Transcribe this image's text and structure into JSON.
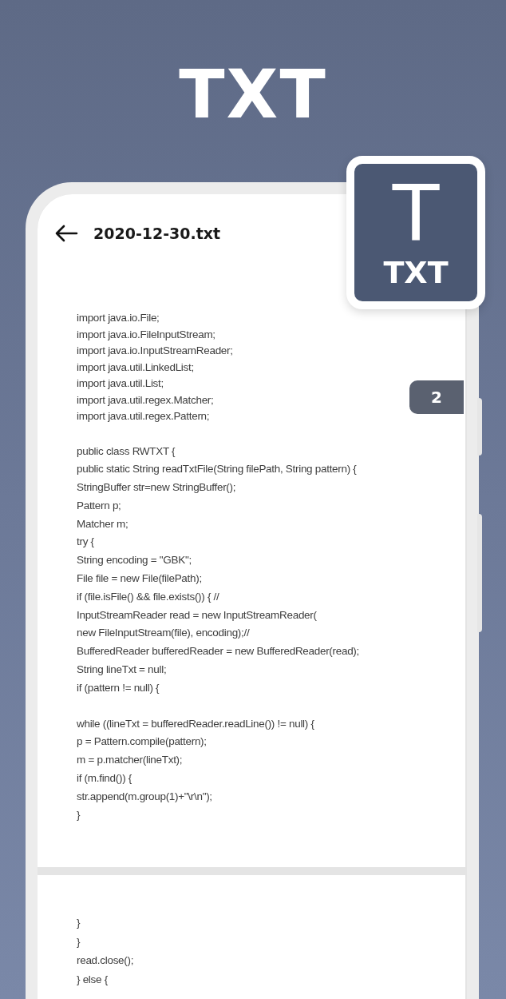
{
  "headline": "TXT",
  "badge": {
    "glyph": "T",
    "label": "TXT"
  },
  "header": {
    "title": "2020-12-30.txt"
  },
  "page_indicator": "2",
  "pages": [
    {
      "blocks": [
        [
          "import java.io.File;",
          "import java.io.FileInputStream;",
          "import java.io.InputStreamReader;",
          "import java.util.LinkedList;",
          "import java.util.List;",
          "import java.util.regex.Matcher;",
          "import java.util.regex.Pattern;"
        ],
        [
          "public class RWTXT {",
          "public static String readTxtFile(String filePath, String pattern) {",
          "StringBuffer str=new StringBuffer();",
          "Pattern p;",
          "Matcher m;",
          "try {",
          "String encoding = \"GBK\";",
          "File file = new File(filePath);",
          "if (file.isFile() && file.exists()) { //",
          "InputStreamReader read = new InputStreamReader(",
          "new FileInputStream(file), encoding);//",
          "BufferedReader bufferedReader = new BufferedReader(read);",
          "String lineTxt = null;",
          "if (pattern != null) {"
        ],
        [
          "while ((lineTxt = bufferedReader.readLine()) != null) {",
          "p = Pattern.compile(pattern);",
          "m = p.matcher(lineTxt);",
          "if (m.find()) {",
          "str.append(m.group(1)+\"\\r\\n\");",
          "}"
        ]
      ]
    },
    {
      "blocks": [
        [
          "}",
          "}",
          "read.close();",
          "} else {"
        ]
      ]
    }
  ]
}
